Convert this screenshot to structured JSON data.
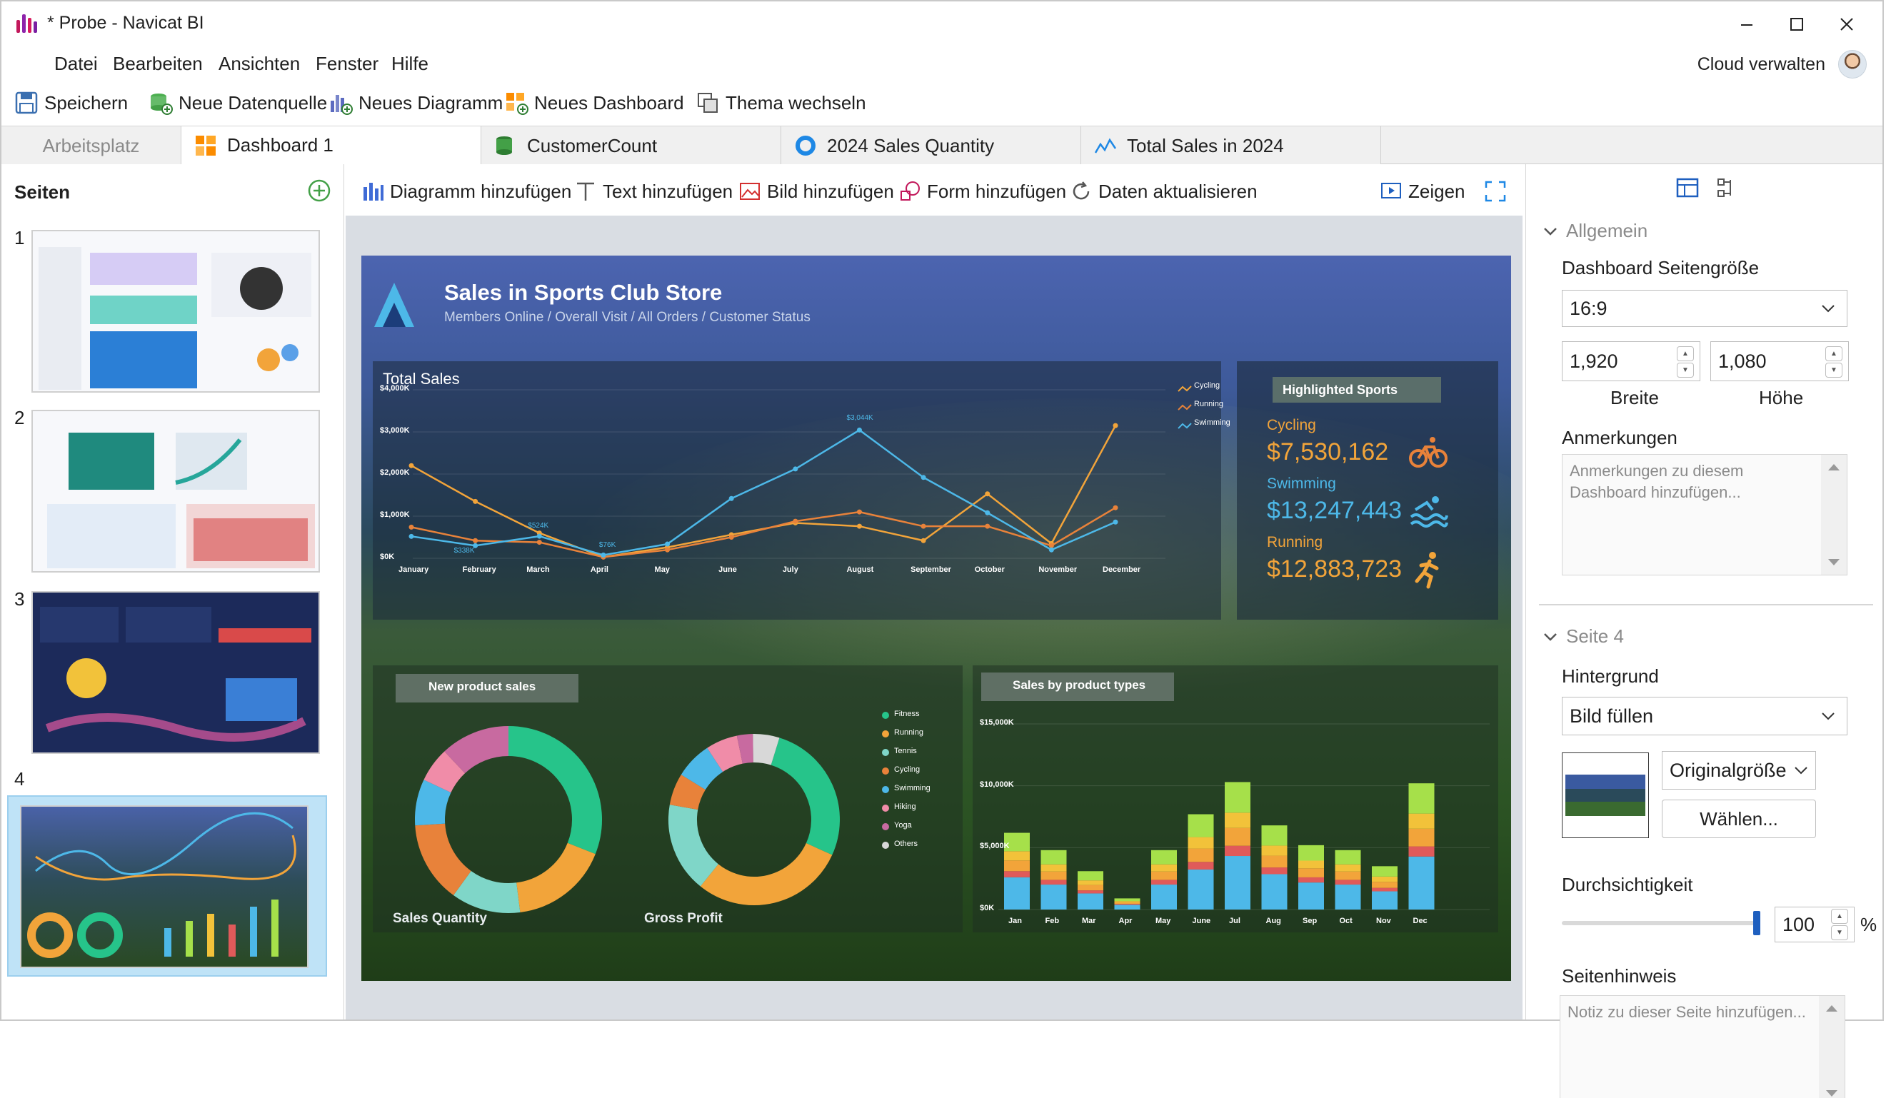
{
  "window": {
    "title": "* Probe - Navicat BI",
    "cloud_label": "Cloud verwalten"
  },
  "menu": [
    "Datei",
    "Bearbeiten",
    "Ansichten",
    "Fenster",
    "Hilfe"
  ],
  "toolbar": {
    "save": "Speichern",
    "new_datasource": "Neue Datenquelle",
    "new_chart": "Neues Diagramm",
    "new_dashboard": "Neues Dashboard",
    "switch_theme": "Thema wechseln"
  },
  "tabs": [
    {
      "label": "Arbeitsplatz"
    },
    {
      "label": "Dashboard 1"
    },
    {
      "label": "CustomerCount"
    },
    {
      "label": "2024 Sales Quantity"
    },
    {
      "label": "Total Sales in 2024"
    }
  ],
  "pages_panel": {
    "title": "Seiten",
    "pages": [
      {
        "number": "1"
      },
      {
        "number": "2"
      },
      {
        "number": "3"
      },
      {
        "number": "4"
      }
    ]
  },
  "canvas_toolbar": {
    "add_chart": "Diagramm hinzufügen",
    "add_text": "Text hinzufügen",
    "add_image": "Bild hinzufügen",
    "add_shape": "Form hinzufügen",
    "refresh": "Daten aktualisieren",
    "show": "Zeigen"
  },
  "dashboard": {
    "title": "Sales in Sports Club Store",
    "subtitle": "Members Online / Overall Visit / All Orders / Customer Status",
    "total_sales": {
      "title": "Total Sales",
      "ylabels": [
        "$4,000K",
        "$3,000K",
        "$2,000K",
        "$1,000K",
        "$0K"
      ],
      "months": [
        "January",
        "February",
        "March",
        "April",
        "May",
        "June",
        "July",
        "August",
        "September",
        "October",
        "November",
        "December"
      ],
      "legend": [
        "Cycling",
        "Running",
        "Swimming"
      ],
      "annotations": [
        "$3,044K",
        "$524K",
        "$338K",
        "$76K"
      ],
      "colors": {
        "cycling": "#f2a43a",
        "running": "#e8823a",
        "swimming": "#4db8e8"
      }
    },
    "highlighted": {
      "title": "Highlighted Sports",
      "items": [
        {
          "name": "Cycling",
          "value": "$7,530,162",
          "color": "#f2a43a",
          "icon": "bicycle-icon"
        },
        {
          "name": "Swimming",
          "value": "$13,247,443",
          "color": "#4db8e8",
          "icon": "swimming-icon"
        },
        {
          "name": "Running",
          "value": "$12,883,723",
          "color": "#f2a43a",
          "icon": "running-icon"
        }
      ]
    },
    "new_product_sales": {
      "title": "New product sales",
      "label_left": "Sales Quantity",
      "label_right": "Gross Profit",
      "legend": [
        "Fitness",
        "Running",
        "Tennis",
        "Cycling",
        "Swimming",
        "Hiking",
        "Yoga",
        "Others"
      ]
    },
    "product_types": {
      "title": "Sales by product types",
      "ylabels": [
        "$15,000K",
        "$10,000K",
        "$5,000K",
        "$0K"
      ],
      "months": [
        "Jan",
        "Feb",
        "Mar",
        "Apr",
        "May",
        "June",
        "Jul",
        "Aug",
        "Sep",
        "Oct",
        "Nov",
        "Dec"
      ]
    }
  },
  "properties": {
    "general_section": "Allgemein",
    "page_size_label": "Dashboard Seitengröße",
    "page_size_value": "16:9",
    "width_value": "1,920",
    "height_value": "1,080",
    "width_label": "Breite",
    "height_label": "Höhe",
    "notes_label": "Anmerkungen",
    "notes_placeholder": "Anmerkungen zu diesem Dashboard hinzufügen...",
    "page_section": "Seite 4",
    "background_label": "Hintergrund",
    "background_value": "Bild füllen",
    "original_size": "Originalgröße",
    "choose_button": "Wählen...",
    "opacity_label": "Durchsichtigkeit",
    "opacity_value": "100",
    "percent": "%",
    "page_hint_label": "Seitenhinweis",
    "page_hint_placeholder": "Notiz zu dieser Seite hinzufügen..."
  }
}
